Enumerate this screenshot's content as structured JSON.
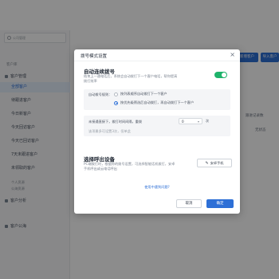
{
  "sidebar": {
    "search_placeholder": "公司管理",
    "section_label": "客户库",
    "items": [
      {
        "label": "客户管理"
      },
      {
        "label": "全部客户"
      },
      {
        "label": "待跟进客户"
      },
      {
        "label": "今日新客户"
      },
      {
        "label": "今天回访客户"
      },
      {
        "label": "今天已回访客户"
      },
      {
        "label": "7天未跟进客户"
      },
      {
        "label": "未领取的客户"
      }
    ],
    "sub_labels": [
      "个人资源",
      "公海资源"
    ],
    "analysis": "客户分析",
    "pool": "客户公海"
  },
  "background": {
    "btn_add": "新增客户",
    "btn_import": "导入客户",
    "cell_1": "跟进记录数",
    "cell_2": "无状态"
  },
  "modal": {
    "title": "拨号模式设置",
    "auto_dial": {
      "title": "自动连续拨号",
      "desc_line1": "结束上一通电话后，系统会自动拨打下一个客户电话，帮你提高",
      "desc_line2": "拨打效率",
      "enabled": true,
      "order_label": "自动拨号规则：",
      "option1": "按列表顺序自动拨打下一个客户",
      "option2": "按优先级筛选后自动拨打，再自动拨打下一个客户",
      "selected_option": 2,
      "interval_label": "未接通直接下，拨打时间间隔，重拨",
      "interval_value": "0",
      "interval_unit": "次",
      "interval_note": "该项最多可设置3次，但单此"
    },
    "dial_device": {
      "title": "选择呼出设备",
      "desc_line1": "PC端拨打时，根据你的拨号设置，可选择智能话机拨打，安卓",
      "desc_line2": "手机呼出或云电话呼出",
      "button": "安卓手机"
    },
    "help_link": "使用中遇到问题?",
    "cancel": "取消",
    "ok": "确定"
  },
  "colors": {
    "accent": "#2d6fd6",
    "toggle_on": "#1fb36b"
  }
}
